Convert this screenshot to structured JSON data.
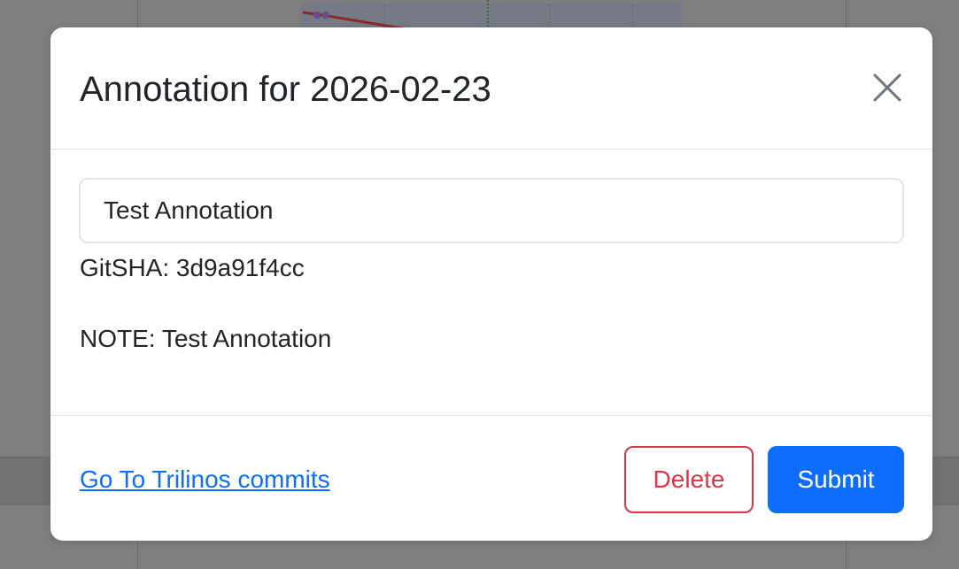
{
  "modal": {
    "title": "Annotation for 2026-02-23",
    "close_icon": "close-icon",
    "input": {
      "value": "Test Annotation",
      "placeholder": ""
    },
    "gitsha_text": "GitSHA: 3d9a91f4cc",
    "note_text": "NOTE: Test Annotation",
    "footer": {
      "link_text": "Go To Trilinos commits",
      "delete_label": "Delete",
      "submit_label": "Submit"
    }
  },
  "colors": {
    "primary": "#0d6efd",
    "danger": "#dc3545",
    "text": "#212529",
    "overlay": "#7f7f7f"
  }
}
